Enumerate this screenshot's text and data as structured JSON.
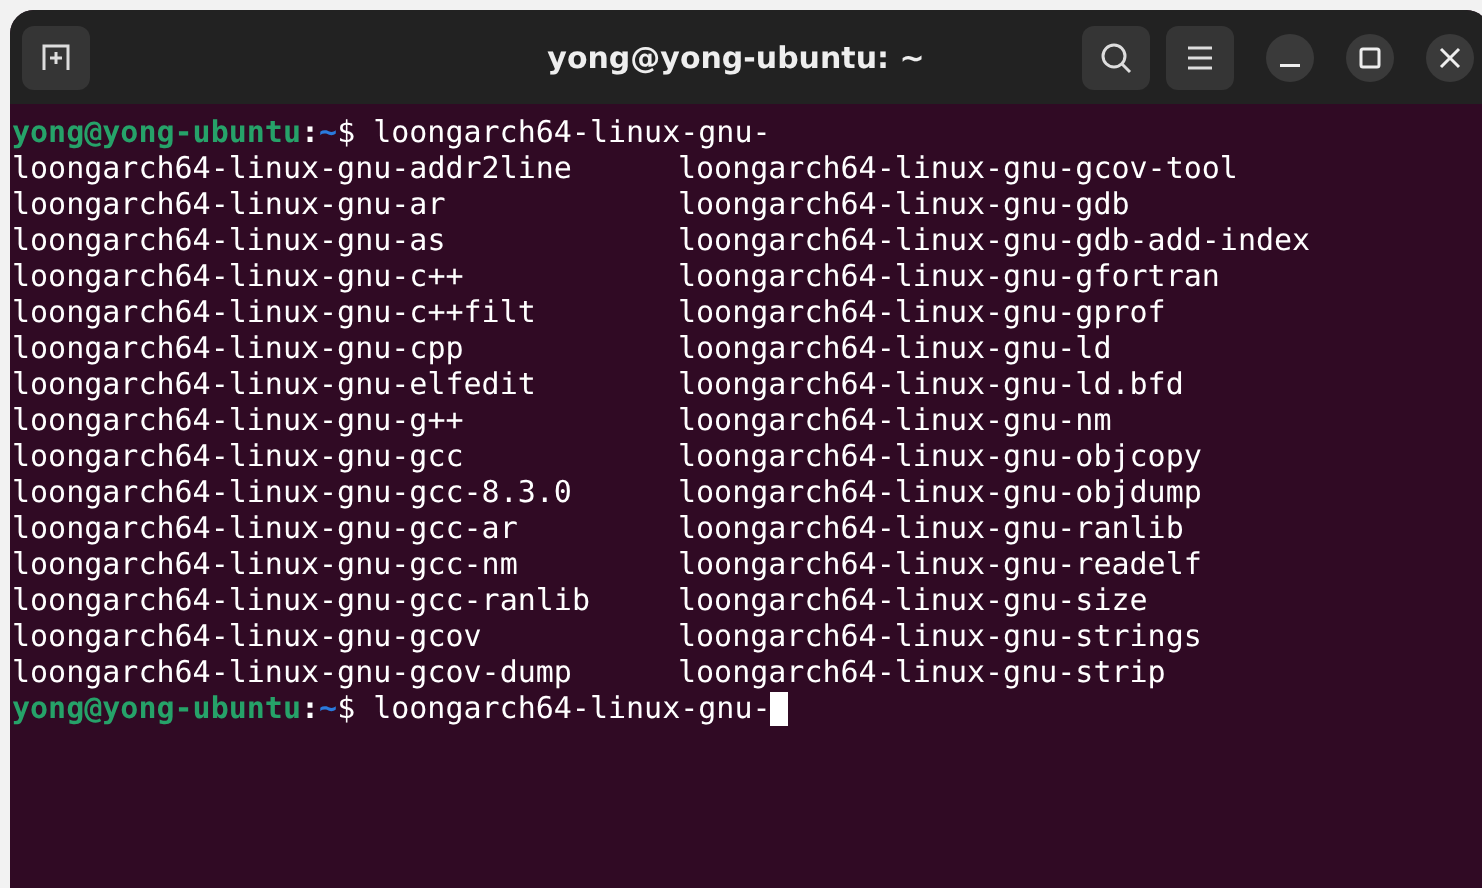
{
  "window": {
    "title": "yong@yong-ubuntu: ~"
  },
  "terminal": {
    "first_prompt": {
      "user_host": "yong@yong-ubuntu",
      "separator": ":",
      "path": "~",
      "symbol": "$",
      "command": "loongarch64-linux-gnu-"
    },
    "completions": [
      [
        "loongarch64-linux-gnu-addr2line",
        "loongarch64-linux-gnu-gcov-tool"
      ],
      [
        "loongarch64-linux-gnu-ar",
        "loongarch64-linux-gnu-gdb"
      ],
      [
        "loongarch64-linux-gnu-as",
        "loongarch64-linux-gnu-gdb-add-index"
      ],
      [
        "loongarch64-linux-gnu-c++",
        "loongarch64-linux-gnu-gfortran"
      ],
      [
        "loongarch64-linux-gnu-c++filt",
        "loongarch64-linux-gnu-gprof"
      ],
      [
        "loongarch64-linux-gnu-cpp",
        "loongarch64-linux-gnu-ld"
      ],
      [
        "loongarch64-linux-gnu-elfedit",
        "loongarch64-linux-gnu-ld.bfd"
      ],
      [
        "loongarch64-linux-gnu-g++",
        "loongarch64-linux-gnu-nm"
      ],
      [
        "loongarch64-linux-gnu-gcc",
        "loongarch64-linux-gnu-objcopy"
      ],
      [
        "loongarch64-linux-gnu-gcc-8.3.0",
        "loongarch64-linux-gnu-objdump"
      ],
      [
        "loongarch64-linux-gnu-gcc-ar",
        "loongarch64-linux-gnu-ranlib"
      ],
      [
        "loongarch64-linux-gnu-gcc-nm",
        "loongarch64-linux-gnu-readelf"
      ],
      [
        "loongarch64-linux-gnu-gcc-ranlib",
        "loongarch64-linux-gnu-size"
      ],
      [
        "loongarch64-linux-gnu-gcov",
        "loongarch64-linux-gnu-strings"
      ],
      [
        "loongarch64-linux-gnu-gcov-dump",
        "loongarch64-linux-gnu-strip"
      ]
    ],
    "second_prompt": {
      "user_host": "yong@yong-ubuntu",
      "separator": ":",
      "path": "~",
      "symbol": "$",
      "command": "loongarch64-linux-gnu-"
    }
  }
}
